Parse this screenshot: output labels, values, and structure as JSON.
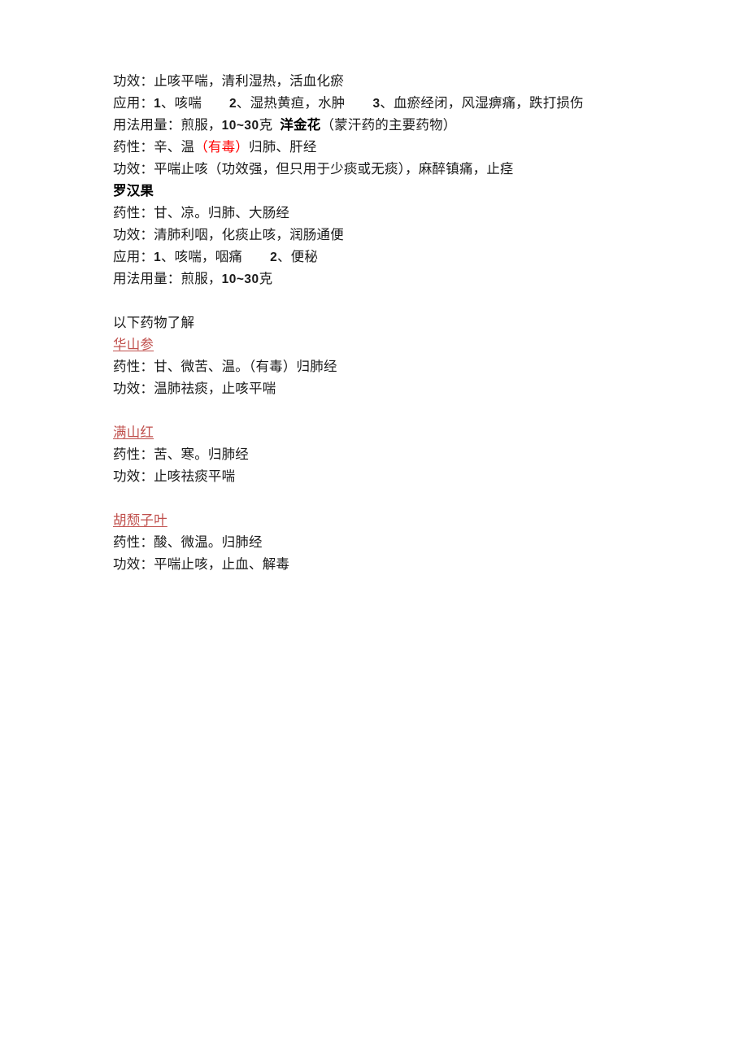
{
  "document": {
    "page_background": "#ffffff",
    "text_color": "#1a1a1a",
    "accent_red_heading": "#C0504D",
    "accent_red_warning": "#FF0000",
    "blocks": [
      {
        "id": "block_yangjinhua_context",
        "lines": [
          {
            "id": "l1",
            "kind": "body",
            "runs": [
              {
                "text": "功效：止咳平喘，清利湿热，活血化瘀",
                "style": "plain"
              }
            ]
          },
          {
            "id": "l2",
            "kind": "body",
            "runs": [
              {
                "text": "应用：",
                "style": "plain"
              },
              {
                "text": "1",
                "style": "num"
              },
              {
                "text": "、咳喘",
                "style": "plain"
              },
              {
                "text": "",
                "style": "gap-m"
              },
              {
                "text": "2",
                "style": "num"
              },
              {
                "text": "、湿热黄疸，水肿",
                "style": "plain"
              },
              {
                "text": "",
                "style": "gap-m"
              },
              {
                "text": "3",
                "style": "num"
              },
              {
                "text": "、血瘀经闭，风湿痹痛，跌打损伤",
                "style": "plain"
              }
            ]
          },
          {
            "id": "l3",
            "kind": "body",
            "runs": [
              {
                "text": "用法用量：煎服，",
                "style": "plain"
              },
              {
                "text": "10~30",
                "style": "dose"
              },
              {
                "text": "克",
                "style": "plain"
              },
              {
                "text": "",
                "style": "gap-xs"
              },
              {
                "text": "洋金花",
                "style": "bold-inline"
              },
              {
                "text": "（蒙汗药的主要药物）",
                "style": "plain"
              }
            ]
          },
          {
            "id": "l4",
            "kind": "body",
            "runs": [
              {
                "text": "药性：辛、温",
                "style": "plain"
              },
              {
                "text": "（有毒）",
                "style": "red-inline"
              },
              {
                "text": "归肺、肝经",
                "style": "plain"
              }
            ]
          },
          {
            "id": "l5",
            "kind": "body",
            "runs": [
              {
                "text": "功效：平喘止咳（功效强，但只用于少痰或无痰），麻醉镇痛，止痉",
                "style": "plain"
              }
            ]
          }
        ]
      },
      {
        "id": "block_luohanguo",
        "lines": [
          {
            "id": "l6",
            "kind": "heading-bold",
            "runs": [
              {
                "text": "罗汉果",
                "style": "head-bold"
              }
            ]
          },
          {
            "id": "l7",
            "kind": "body",
            "runs": [
              {
                "text": "药性：甘、凉。归肺、大肠经",
                "style": "plain"
              }
            ]
          },
          {
            "id": "l8",
            "kind": "body",
            "runs": [
              {
                "text": "功效：清肺利咽，化痰止咳，润肠通便",
                "style": "plain"
              }
            ]
          },
          {
            "id": "l9",
            "kind": "body",
            "runs": [
              {
                "text": "应用：",
                "style": "plain"
              },
              {
                "text": "1",
                "style": "num"
              },
              {
                "text": "、咳喘，咽痛",
                "style": "plain"
              },
              {
                "text": "",
                "style": "gap-m"
              },
              {
                "text": "2",
                "style": "num"
              },
              {
                "text": "、便秘",
                "style": "plain"
              }
            ]
          },
          {
            "id": "l10",
            "kind": "body",
            "runs": [
              {
                "text": "用法用量：煎服，",
                "style": "plain"
              },
              {
                "text": "10~30",
                "style": "dose"
              },
              {
                "text": "克",
                "style": "plain"
              }
            ]
          }
        ]
      },
      {
        "id": "block_spacer_1",
        "lines": [
          {
            "id": "s1",
            "kind": "blank",
            "runs": []
          }
        ]
      },
      {
        "id": "block_note",
        "lines": [
          {
            "id": "l11",
            "kind": "body",
            "runs": [
              {
                "text": "以下药物了解",
                "style": "plain"
              }
            ]
          }
        ]
      },
      {
        "id": "block_huashanshen",
        "lines": [
          {
            "id": "l12",
            "kind": "heading-red",
            "runs": [
              {
                "text": "华山参",
                "style": "head-red"
              }
            ]
          },
          {
            "id": "l13",
            "kind": "body",
            "runs": [
              {
                "text": "药性：甘、微苦、温。（有毒）归肺经",
                "style": "plain"
              }
            ]
          },
          {
            "id": "l14",
            "kind": "body",
            "runs": [
              {
                "text": "功效：温肺祛痰，止咳平喘",
                "style": "plain"
              }
            ]
          }
        ]
      },
      {
        "id": "block_spacer_2",
        "lines": [
          {
            "id": "s2",
            "kind": "blank",
            "runs": []
          }
        ]
      },
      {
        "id": "block_manshanhong",
        "lines": [
          {
            "id": "l15",
            "kind": "heading-red",
            "runs": [
              {
                "text": "满山红",
                "style": "head-red"
              }
            ]
          },
          {
            "id": "l16",
            "kind": "body",
            "runs": [
              {
                "text": "药性：苦、寒。归肺经",
                "style": "plain"
              }
            ]
          },
          {
            "id": "l17",
            "kind": "body",
            "runs": [
              {
                "text": "功效：止咳祛痰平喘",
                "style": "plain"
              }
            ]
          }
        ]
      },
      {
        "id": "block_spacer_3",
        "lines": [
          {
            "id": "s3",
            "kind": "blank",
            "runs": []
          }
        ]
      },
      {
        "id": "block_hutuiziye",
        "lines": [
          {
            "id": "l18",
            "kind": "heading-red",
            "runs": [
              {
                "text": "胡颓子叶",
                "style": "head-red"
              }
            ]
          },
          {
            "id": "l19",
            "kind": "body",
            "runs": [
              {
                "text": "药性：酸、微温。归肺经",
                "style": "plain"
              }
            ]
          },
          {
            "id": "l20",
            "kind": "body",
            "runs": [
              {
                "text": "功效：平喘止咳，止血、解毒",
                "style": "plain"
              }
            ]
          }
        ]
      }
    ]
  }
}
